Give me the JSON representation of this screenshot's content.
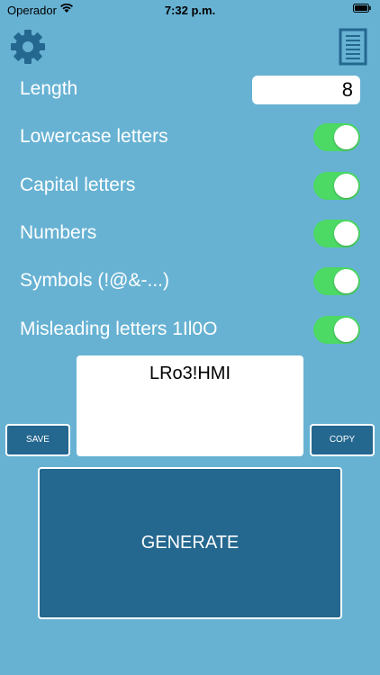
{
  "status_bar": {
    "carrier": "Operador",
    "time": "7:32 p.m."
  },
  "toolbar": {
    "settings_icon": "gear-icon",
    "history_icon": "document-list-icon"
  },
  "options": {
    "length": {
      "label": "Length",
      "value": "8"
    },
    "toggles": [
      {
        "label": "Lowercase letters",
        "on": true
      },
      {
        "label": "Capital letters",
        "on": true
      },
      {
        "label": "Numbers",
        "on": true
      },
      {
        "label": "Symbols (!@&-...)",
        "on": true
      },
      {
        "label": "Misleading letters 1Il0O",
        "on": true
      }
    ]
  },
  "result": {
    "password": "LRo3!HMI"
  },
  "buttons": {
    "save": "SAVE",
    "copy": "COPY",
    "generate": "GENERATE"
  },
  "colors": {
    "background": "#67b2d3",
    "button": "#24678f",
    "toggle_on": "#4cd964"
  }
}
